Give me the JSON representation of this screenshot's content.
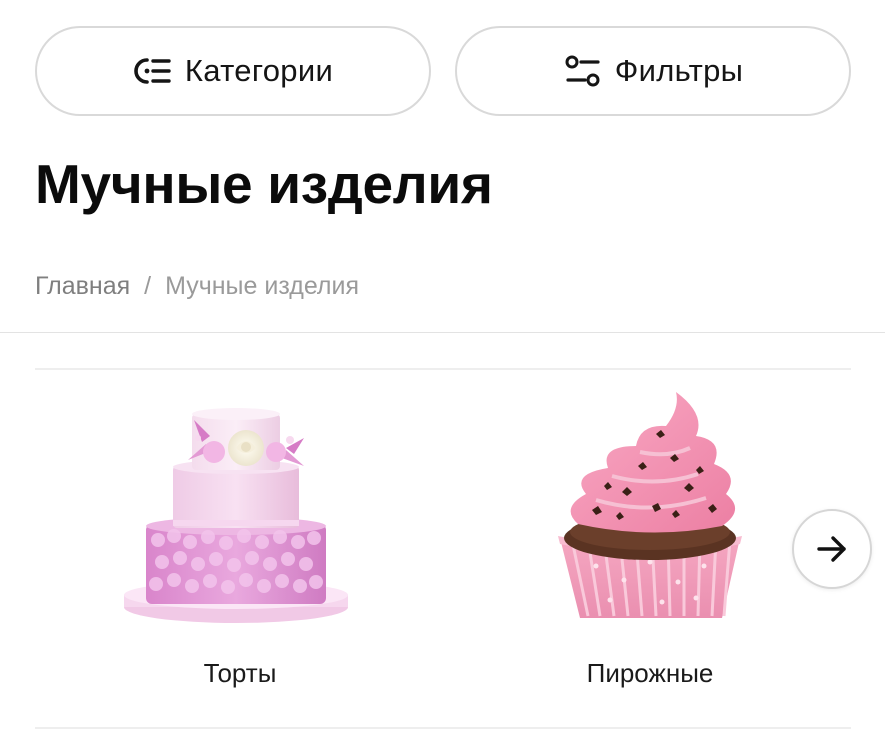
{
  "toolbar": {
    "categories_label": "Категории",
    "filters_label": "Фильтры"
  },
  "page": {
    "title": "Мучные изделия"
  },
  "breadcrumb": {
    "home": "Главная",
    "separator": "/",
    "current": "Мучные изделия"
  },
  "categories": [
    {
      "label": "Торты",
      "icon": "tiered-cake-image"
    },
    {
      "label": "Пирожные",
      "icon": "cupcake-image"
    }
  ],
  "carousel": {
    "next_icon": "arrow-right-icon"
  },
  "colors": {
    "border": "#d9d9d9",
    "title": "#0b0b0b",
    "breadcrumb": "#8e8e8e",
    "cake_pink": "#e6a6dc",
    "frosting_pink": "#f08fb0",
    "chocolate": "#5a3322"
  }
}
